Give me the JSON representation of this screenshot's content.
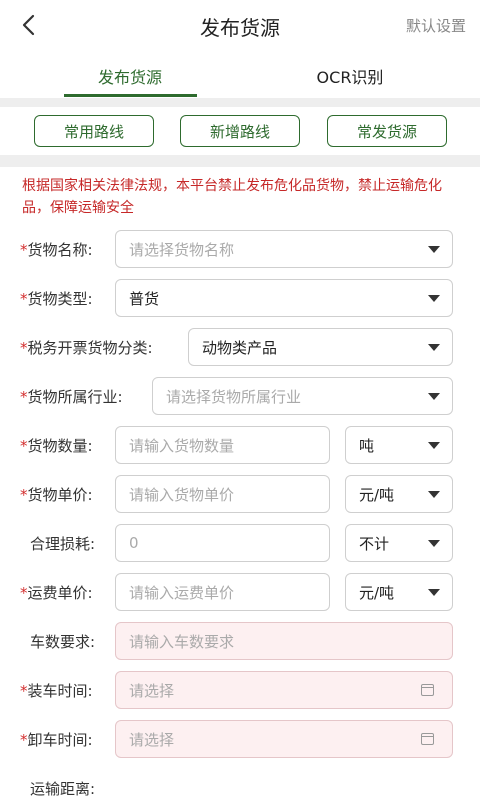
{
  "header": {
    "title": "发布货源",
    "right_action": "默认设置",
    "back_icon": "chevron-left-icon"
  },
  "tabs": [
    {
      "label": "发布货源",
      "active": true
    },
    {
      "label": "OCR识别",
      "active": false
    }
  ],
  "route_buttons": [
    "常用路线",
    "新增路线",
    "常发货源"
  ],
  "warning": "根据国家相关法律法规，本平台禁止发布危化品货物，禁止运输危化品，保障运输安全",
  "form": {
    "cargo_name": {
      "label": "货物名称:",
      "placeholder": "请选择货物名称"
    },
    "cargo_type": {
      "label": "货物类型:",
      "value": "普货"
    },
    "tax_class": {
      "label": "税务开票货物分类:",
      "value": "动物类产品"
    },
    "industry": {
      "label": "货物所属行业:",
      "placeholder": "请选择货物所属行业"
    },
    "quantity": {
      "label": "货物数量:",
      "placeholder": "请输入货物数量",
      "unit": "吨"
    },
    "unit_price": {
      "label": "货物单价:",
      "placeholder": "请输入货物单价",
      "unit": "元/吨"
    },
    "loss": {
      "label": "合理损耗:",
      "placeholder": "0",
      "unit": "不计"
    },
    "freight_price": {
      "label": "运费单价:",
      "placeholder": "请输入运费单价",
      "unit": "元/吨"
    },
    "truck_count": {
      "label": "车数要求:",
      "placeholder": "请输入车数要求"
    },
    "load_time": {
      "label": "装车时间:",
      "placeholder": "请选择"
    },
    "unload_time": {
      "label": "卸车时间:",
      "placeholder": "请选择"
    },
    "distance": {
      "label": "运输距离:"
    }
  },
  "required_mark": "*",
  "colors": {
    "accent": "#2e6b2e",
    "warning": "#c62828",
    "required": "#d32f2f",
    "pink_field": "#fdf0f1"
  }
}
